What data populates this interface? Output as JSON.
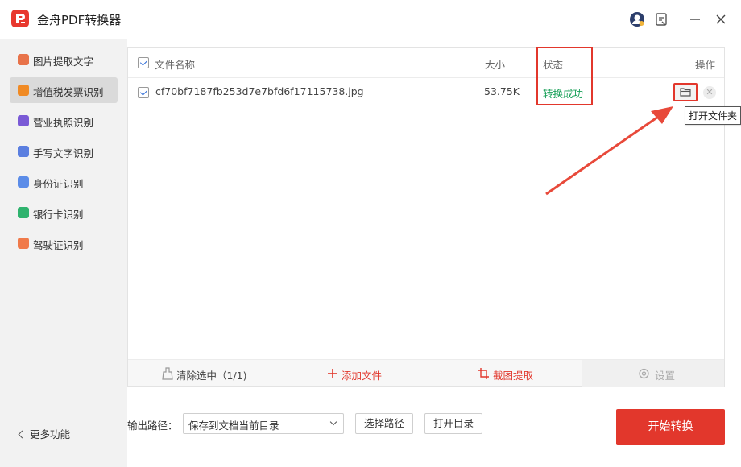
{
  "app": {
    "title": "金舟PDF转换器"
  },
  "titlebar": {
    "icons": [
      "user-avatar-icon",
      "feedback-icon",
      "minimize-icon",
      "close-icon"
    ]
  },
  "sidebar": {
    "items": [
      {
        "label": "图片提取文字",
        "icon": "image-text-icon",
        "color": "#e8734a",
        "active": false
      },
      {
        "label": "增值税发票识别",
        "icon": "invoice-icon",
        "color": "#f08a24",
        "active": true
      },
      {
        "label": "营业执照识别",
        "icon": "license-icon",
        "color": "#7a5ad6",
        "active": false
      },
      {
        "label": "手写文字识别",
        "icon": "handwriting-icon",
        "color": "#5b7fe0",
        "active": false
      },
      {
        "label": "身份证识别",
        "icon": "id-card-icon",
        "color": "#5b8ce8",
        "active": false
      },
      {
        "label": "银行卡识别",
        "icon": "bank-card-icon",
        "color": "#2fb36e",
        "active": false
      },
      {
        "label": "驾驶证识别",
        "icon": "driving-license-icon",
        "color": "#f07a4a",
        "active": false
      }
    ],
    "more_label": "更多功能"
  },
  "table": {
    "headers": {
      "name": "文件名称",
      "size": "大小",
      "status": "状态",
      "actions": "操作"
    },
    "rows": [
      {
        "name": "cf70bf7187fb253d7e7bfd6f17115738.jpg",
        "size": "53.75K",
        "status": "转换成功",
        "checked": true
      }
    ],
    "tooltip": "打开文件夹"
  },
  "toolbar": {
    "clear": "清除选中（1/1)",
    "add": "添加文件",
    "screenshot": "截图提取",
    "settings": "设置"
  },
  "output": {
    "label": "输出路径：",
    "path": "保存到文档当前目录",
    "choose_button": "选择路径",
    "open_button": "打开目录"
  },
  "start_button": "开始转换",
  "colors": {
    "accent": "#e2372c",
    "success": "#18a058",
    "check": "#2c6ad6"
  }
}
